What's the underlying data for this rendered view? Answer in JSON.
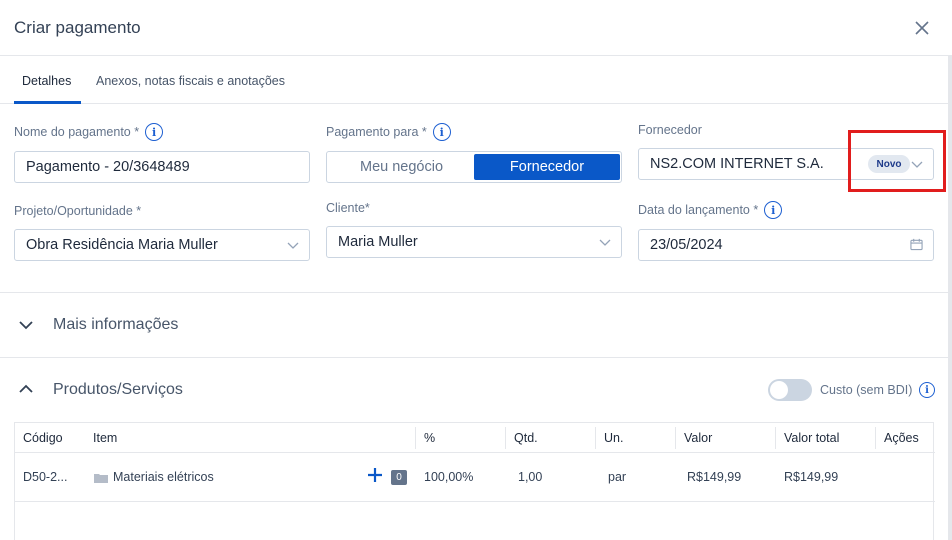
{
  "header": {
    "title": "Criar pagamento"
  },
  "tabs": [
    {
      "label": "Detalhes"
    },
    {
      "label": "Anexos, notas fiscais e anotações"
    }
  ],
  "form": {
    "nome": {
      "label": "Nome do pagamento *",
      "value": "Pagamento - 20/3648489"
    },
    "pagamento_para": {
      "label": "Pagamento para *",
      "options": [
        "Meu negócio",
        "Fornecedor"
      ],
      "selected": "Fornecedor"
    },
    "fornecedor": {
      "label": "Fornecedor",
      "value": "NS2.COM INTERNET S.A.",
      "badge": "Novo"
    },
    "projeto": {
      "label": "Projeto/Oportunidade *",
      "value": "Obra Residência Maria Muller"
    },
    "cliente": {
      "label": "Cliente*",
      "value": "Maria Muller"
    },
    "data": {
      "label": "Data do lançamento *",
      "value": "23/05/2024"
    }
  },
  "sections": {
    "mais_info": "Mais informações",
    "produtos": "Produtos/Serviços"
  },
  "custo_toggle": {
    "label": "Custo (sem BDI)",
    "on": false
  },
  "table": {
    "headers": [
      "Código",
      "Item",
      "%",
      "Qtd.",
      "Un.",
      "Valor",
      "Valor total",
      "Ações"
    ],
    "rows": [
      {
        "codigo": "D50-2...",
        "item": "Materiais elétricos",
        "count": "0",
        "percent": "100,00%",
        "qtd": "1,00",
        "un": "par",
        "valor": "R$149,99",
        "valor_total": "R$149,99"
      }
    ]
  },
  "colors": {
    "primary": "#0a58c8",
    "highlight": "#e11d1d"
  },
  "icons": [
    "close-icon",
    "info-icon",
    "chevron-down-icon",
    "calendar-icon",
    "chevron-up-icon",
    "plus-icon",
    "folder-icon"
  ]
}
